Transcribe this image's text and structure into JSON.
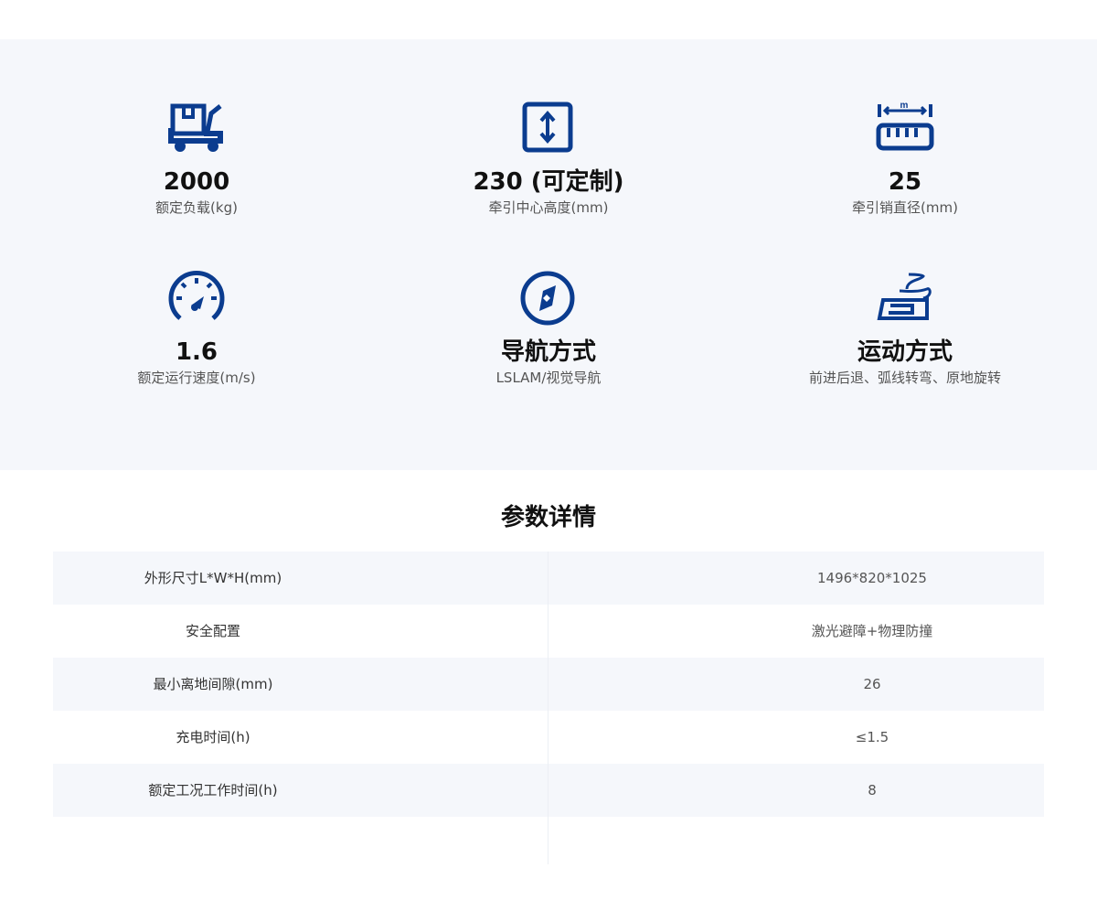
{
  "features": [
    {
      "icon": "cart-icon",
      "value": "2000",
      "label": "额定负载(kg)"
    },
    {
      "icon": "height-icon",
      "value": "230 (可定制)",
      "label": "牵引中心高度(mm)"
    },
    {
      "icon": "ruler-icon",
      "value": "25",
      "label": "牵引销直径(mm)",
      "icon_text": "m"
    },
    {
      "icon": "speedometer-icon",
      "value": "1.6",
      "label": "额定运行速度(m/s)"
    },
    {
      "icon": "compass-icon",
      "value": "导航方式",
      "label": "LSLAM/视觉导航"
    },
    {
      "icon": "motion-icon",
      "value": "运动方式",
      "label": "前进后退、弧线转弯、原地旋转"
    }
  ],
  "specs": {
    "title": "参数详情",
    "rows": [
      {
        "key": "外形尺寸L*W*H(mm)",
        "value": "1496*820*1025"
      },
      {
        "key": "安全配置",
        "value": "激光避障+物理防撞"
      },
      {
        "key": "最小离地间隙(mm)",
        "value": "26"
      },
      {
        "key": "充电时间(h)",
        "value": "≤1.5"
      },
      {
        "key": "额定工况工作时间(h)",
        "value": "8"
      }
    ]
  },
  "colors": {
    "accent": "#0b3c8f",
    "panel_bg": "#f5f7fb"
  }
}
